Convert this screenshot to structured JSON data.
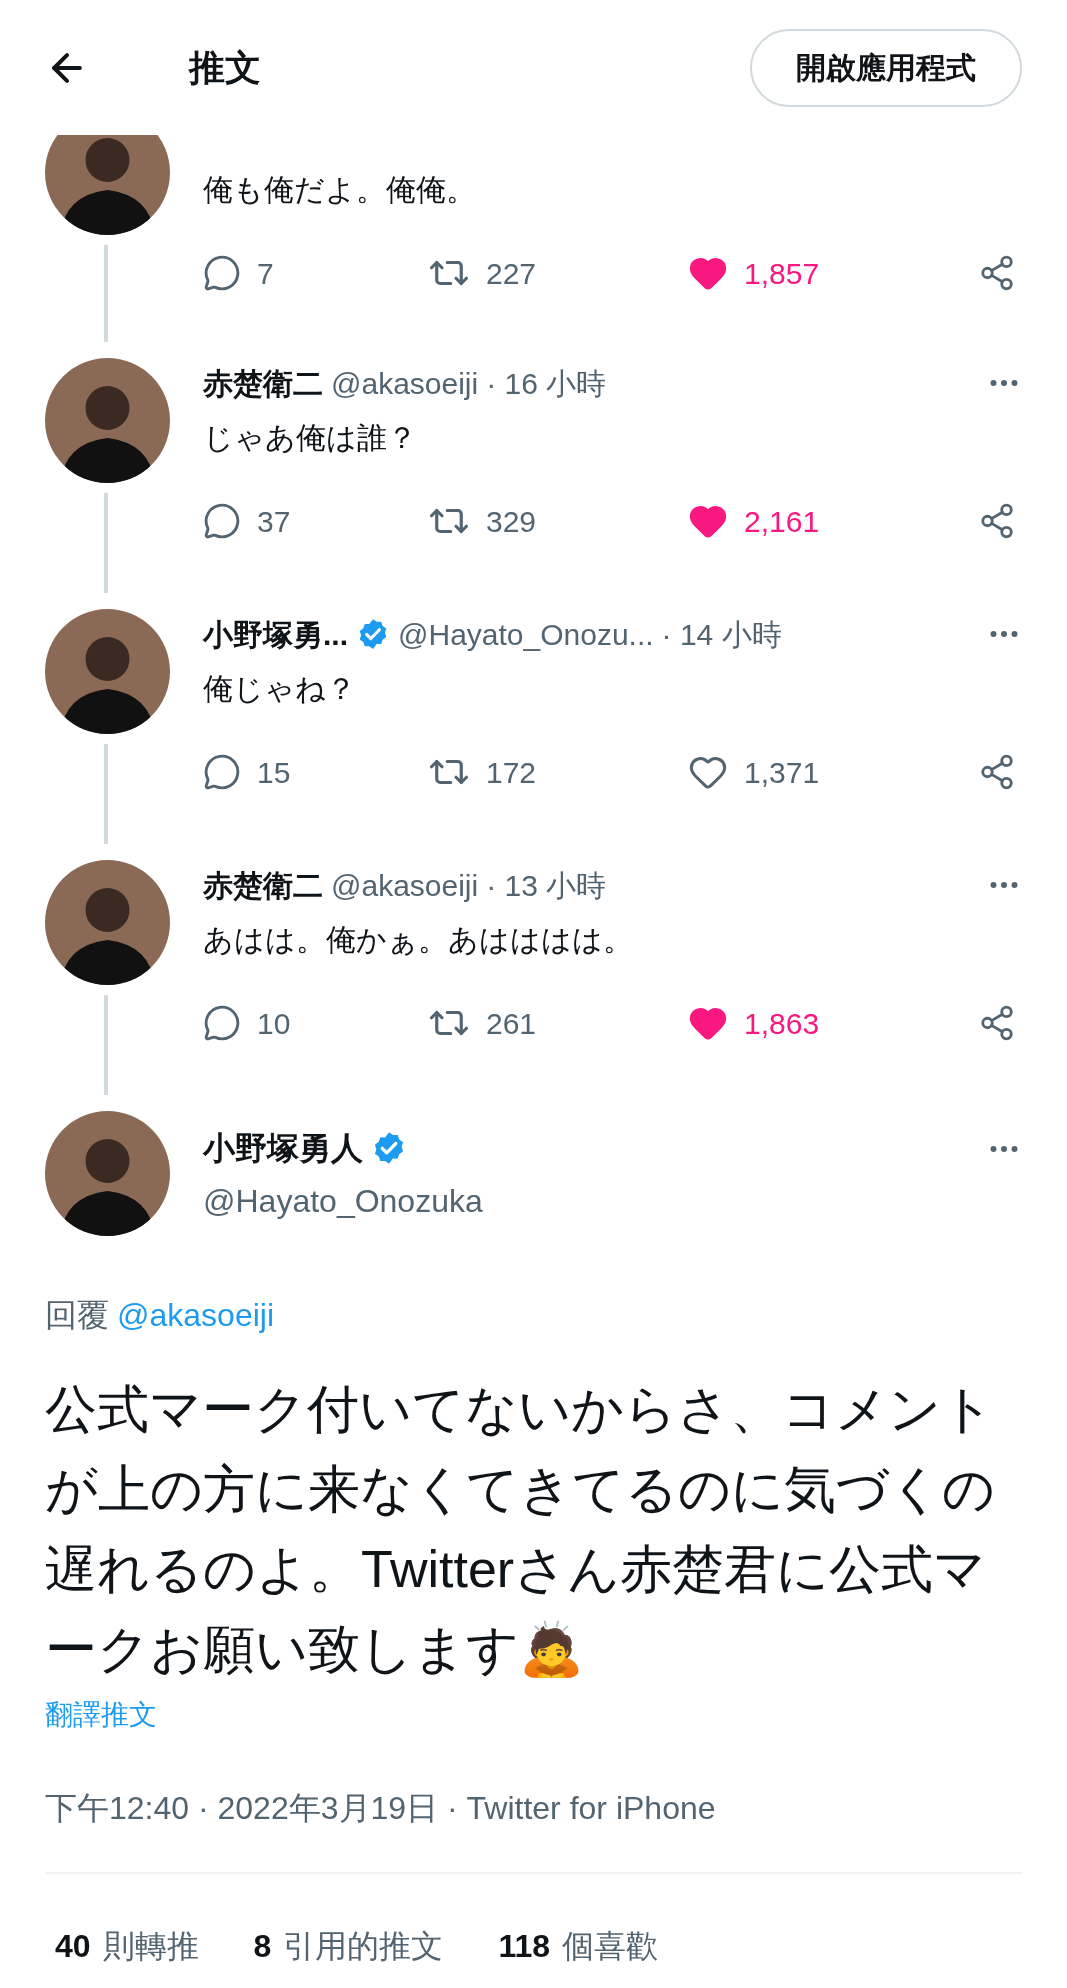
{
  "header": {
    "title": "推文",
    "open_app_button": "開啟應用程式"
  },
  "thread": [
    {
      "text": "俺も俺だよ。俺俺。",
      "replies": "7",
      "retweets": "227",
      "likes": "1,857",
      "liked": true
    },
    {
      "name": "赤楚衛二",
      "verified": false,
      "handle": "@akasoeiji",
      "time": "· 16 小時",
      "text": "じゃあ俺は誰？",
      "replies": "37",
      "retweets": "329",
      "likes": "2,161",
      "liked": true
    },
    {
      "name": "小野塚勇...",
      "verified": true,
      "handle": "@Hayato_Onozu...",
      "time": "· 14 小時",
      "text": "俺じゃね？",
      "replies": "15",
      "retweets": "172",
      "likes": "1,371",
      "liked": false
    },
    {
      "name": "赤楚衛二",
      "verified": false,
      "handle": "@akasoeiji",
      "time": "· 13 小時",
      "text": "あはは。俺かぁ。あはははは。",
      "replies": "10",
      "retweets": "261",
      "likes": "1,863",
      "liked": true
    }
  ],
  "main_tweet": {
    "name": "小野塚勇人",
    "verified": true,
    "handle": "@Hayato_Onozuka",
    "reply_label": "回覆",
    "reply_to": "@akasoeiji",
    "text": "公式マーク付いてないからさ、コメントが上の方に来なくてきてるのに気づくの遅れるのよ。Twitterさん赤楚君に公式マークお願い致します🙇",
    "translate": "翻譯推文",
    "timestamp": "下午12:40 · 2022年3月19日 · Twitter for iPhone",
    "stats": [
      {
        "count": "40",
        "label": "則轉推"
      },
      {
        "count": "8",
        "label": "引用的推文"
      },
      {
        "count": "118",
        "label": "個喜歡"
      }
    ]
  }
}
